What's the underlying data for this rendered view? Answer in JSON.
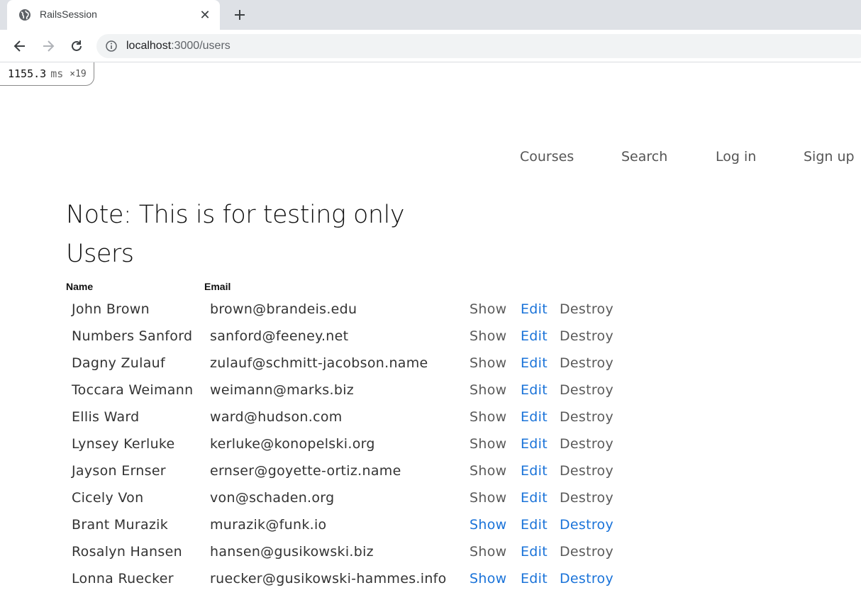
{
  "browser": {
    "tab_title": "RailsSession",
    "url_host": "localhost",
    "url_path": ":3000/users"
  },
  "profiler": {
    "time": "1155.3",
    "unit": "ms",
    "count": "×19"
  },
  "nav": {
    "items": [
      {
        "label": "Courses"
      },
      {
        "label": "Search"
      },
      {
        "label": "Log in"
      },
      {
        "label": "Sign up"
      }
    ]
  },
  "page": {
    "note": "Note: This is for testing only",
    "title": "Users",
    "headers": {
      "name": "Name",
      "email": "Email"
    },
    "action_labels": {
      "show": "Show",
      "edit": "Edit",
      "destroy": "Destroy"
    }
  },
  "users": [
    {
      "name": "John Brown",
      "email": "brown@brandeis.edu",
      "show": "Show",
      "edit": "Edit",
      "destroy": "Destroy",
      "show_color": "#5a5a5a",
      "edit_color": "#1a73d9",
      "destroy_color": "#5a5a5a"
    },
    {
      "name": "Numbers Sanford",
      "email": "sanford@feeney.net",
      "show": "Show",
      "edit": "Edit",
      "destroy": "Destroy",
      "show_color": "#5a5a5a",
      "edit_color": "#1a73d9",
      "destroy_color": "#5a5a5a"
    },
    {
      "name": "Dagny Zulauf",
      "email": "zulauf@schmitt-jacobson.name",
      "show": "Show",
      "edit": "Edit",
      "destroy": "Destroy",
      "show_color": "#5a5a5a",
      "edit_color": "#1a73d9",
      "destroy_color": "#5a5a5a"
    },
    {
      "name": "Toccara Weimann",
      "email": "weimann@marks.biz",
      "show": "Show",
      "edit": "Edit",
      "destroy": "Destroy",
      "show_color": "#5a5a5a",
      "edit_color": "#1a73d9",
      "destroy_color": "#5a5a5a"
    },
    {
      "name": "Ellis Ward",
      "email": "ward@hudson.com",
      "show": "Show",
      "edit": "Edit",
      "destroy": "Destroy",
      "show_color": "#5a5a5a",
      "edit_color": "#1a73d9",
      "destroy_color": "#5a5a5a"
    },
    {
      "name": "Lynsey Kerluke",
      "email": "kerluke@konopelski.org",
      "show": "Show",
      "edit": "Edit",
      "destroy": "Destroy",
      "show_color": "#5a5a5a",
      "edit_color": "#1a73d9",
      "destroy_color": "#5a5a5a"
    },
    {
      "name": "Jayson Ernser",
      "email": "ernser@goyette-ortiz.name",
      "show": "Show",
      "edit": "Edit",
      "destroy": "Destroy",
      "show_color": "#5a5a5a",
      "edit_color": "#1a73d9",
      "destroy_color": "#5a5a5a"
    },
    {
      "name": "Cicely Von",
      "email": "von@schaden.org",
      "show": "Show",
      "edit": "Edit",
      "destroy": "Destroy",
      "show_color": "#5a5a5a",
      "edit_color": "#1a73d9",
      "destroy_color": "#5a5a5a"
    },
    {
      "name": "Brant Murazik",
      "email": "murazik@funk.io",
      "show": "Show",
      "edit": "Edit",
      "destroy": "Destroy",
      "show_color": "#1a73d9",
      "edit_color": "#1a73d9",
      "destroy_color": "#1a73d9"
    },
    {
      "name": "Rosalyn Hansen",
      "email": "hansen@gusikowski.biz",
      "show": "Show",
      "edit": "Edit",
      "destroy": "Destroy",
      "show_color": "#5a5a5a",
      "edit_color": "#1a73d9",
      "destroy_color": "#5a5a5a"
    },
    {
      "name": "Lonna Ruecker",
      "email": "ruecker@gusikowski-hammes.info",
      "show": "Show",
      "edit": "Edit",
      "destroy": "Destroy",
      "show_color": "#1a73d9",
      "edit_color": "#1a73d9",
      "destroy_color": "#1a73d9"
    }
  ]
}
